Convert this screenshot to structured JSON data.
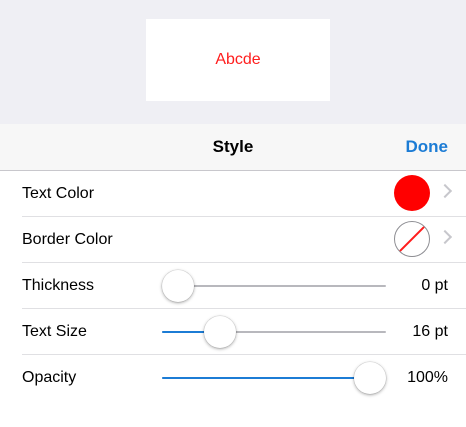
{
  "preview": {
    "text": "Abcde",
    "text_color": "#ff1d1d"
  },
  "nav": {
    "title": "Style",
    "done_label": "Done",
    "accent": "#1c7cd5"
  },
  "rows": {
    "text_color": {
      "label": "Text Color",
      "swatch": "#ff0000"
    },
    "border_color": {
      "label": "Border Color",
      "swatch": "none"
    },
    "thickness": {
      "label": "Thickness",
      "value": "0 pt",
      "fraction": 0.0
    },
    "text_size": {
      "label": "Text Size",
      "value": "16 pt",
      "fraction": 0.22
    },
    "opacity": {
      "label": "Opacity",
      "value": "100%",
      "fraction": 1.0
    }
  },
  "colors": {
    "slider_fill": "#1c7cd5"
  }
}
